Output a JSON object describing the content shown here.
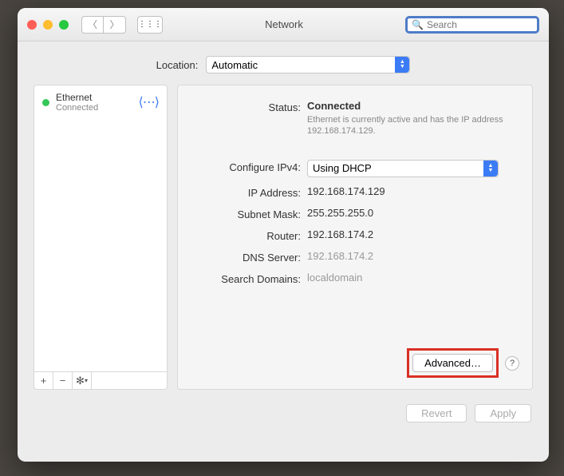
{
  "window": {
    "title": "Network",
    "search_placeholder": "Search"
  },
  "location": {
    "label": "Location:",
    "value": "Automatic"
  },
  "sidebar": {
    "items": [
      {
        "name": "Ethernet",
        "status": "Connected"
      }
    ],
    "toolbar": {
      "add": "+",
      "remove": "−",
      "gear": "✻▾"
    }
  },
  "detail": {
    "status": {
      "label": "Status:",
      "value": "Connected",
      "sub": "Ethernet is currently active and has the IP address 192.168.174.129."
    },
    "configure": {
      "label": "Configure IPv4:",
      "value": "Using DHCP"
    },
    "ip": {
      "label": "IP Address:",
      "value": "192.168.174.129"
    },
    "subnet": {
      "label": "Subnet Mask:",
      "value": "255.255.255.0"
    },
    "router": {
      "label": "Router:",
      "value": "192.168.174.2"
    },
    "dns": {
      "label": "DNS Server:",
      "value": "192.168.174.2"
    },
    "search_domains": {
      "label": "Search Domains:",
      "value": "localdomain"
    },
    "advanced_btn": "Advanced…",
    "help": "?"
  },
  "footer": {
    "revert": "Revert",
    "apply": "Apply"
  }
}
